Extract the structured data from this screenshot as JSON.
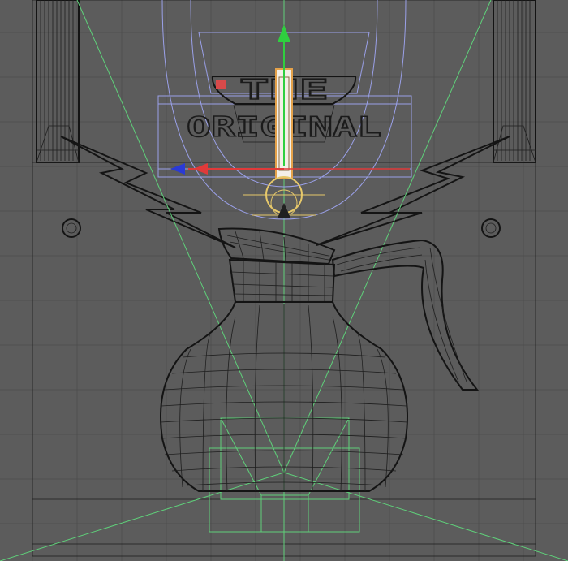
{
  "scene": {
    "logo": {
      "line1": "THE",
      "line2": "ORIGINAL"
    },
    "colors": {
      "background": "#5c5c5c",
      "grid": "#4f4f4f",
      "wire": "#1e1e1e",
      "camera_frustum": "#5fd07a",
      "bounding_box": "#9aa0e8",
      "gizmo_y": "#2fcf3f",
      "gizmo_x": "#e03a3a",
      "gizmo_x_alt": "#2a3ad6",
      "light": "#f0e0b0"
    },
    "icons": [
      "move-gizmo-icon",
      "light-icon"
    ]
  }
}
